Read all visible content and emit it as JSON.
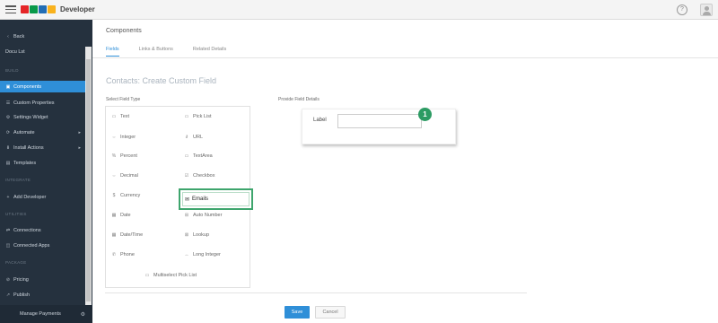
{
  "app": {
    "title": "Developer",
    "logo_colors": [
      "#e42527",
      "#089949",
      "#226db4",
      "#f9b21d"
    ]
  },
  "topbar": {
    "help_icon": "help-icon",
    "user_icon": "user-icon"
  },
  "sidebar": {
    "back_label": "Back",
    "app_name": "Docu Lst",
    "sections": {
      "build": "BUILD",
      "integrate": "INTEGRATE",
      "utilities": "UTILITIES",
      "package": "PACKAGE"
    },
    "items": [
      {
        "label": "Components",
        "icon": "components-icon",
        "active": true
      },
      {
        "label": "Custom Properties",
        "icon": "properties-icon"
      },
      {
        "label": "Settings Widget",
        "icon": "settings-icon"
      },
      {
        "label": "Automate",
        "icon": "automate-icon"
      },
      {
        "label": "Install Actions",
        "icon": "install-icon"
      },
      {
        "label": "Templates",
        "icon": "templates-icon"
      },
      {
        "label": "Add Developer",
        "icon": "add-developer-icon"
      },
      {
        "label": "Connections",
        "icon": "connections-icon"
      },
      {
        "label": "Connected Apps",
        "icon": "connected-apps-icon"
      },
      {
        "label": "Pricing",
        "icon": "pricing-icon"
      },
      {
        "label": "Publish",
        "icon": "publish-icon"
      }
    ],
    "footer_label": "Manage Payments",
    "accent_color": "#2f8fd8"
  },
  "page": {
    "title": "Components",
    "tabs": [
      {
        "label": "Fields",
        "active": true
      },
      {
        "label": "Links & Buttons"
      },
      {
        "label": "Related Details"
      }
    ],
    "form_title": "Contacts: Create Custom Field",
    "select_field_type_label": "Select Field Type",
    "provide_details_label": "Provide Field Details"
  },
  "field_types": [
    {
      "label": "Text",
      "icon": "text-icon"
    },
    {
      "label": "Pick List",
      "icon": "picklist-icon"
    },
    {
      "label": "Integer",
      "icon": "integer-icon"
    },
    {
      "label": "URL",
      "icon": "url-icon"
    },
    {
      "label": "Percent",
      "icon": "percent-icon"
    },
    {
      "label": "TextArea",
      "icon": "textarea-icon"
    },
    {
      "label": "Decimal",
      "icon": "decimal-icon"
    },
    {
      "label": "Checkbox",
      "icon": "checkbox-icon"
    },
    {
      "label": "Currency",
      "icon": "currency-icon"
    },
    {
      "label": "Emails",
      "icon": "email-icon",
      "highlighted": true
    },
    {
      "label": "Date",
      "icon": "date-icon"
    },
    {
      "label": "Auto Number",
      "icon": "autonumber-icon"
    },
    {
      "label": "Date/Time",
      "icon": "datetime-icon"
    },
    {
      "label": "Lookup",
      "icon": "lookup-icon"
    },
    {
      "label": "Phone",
      "icon": "phone-icon"
    },
    {
      "label": "Long Integer",
      "icon": "longinteger-icon"
    },
    {
      "label": "Multiselect Pick List",
      "icon": "multiselect-icon"
    }
  ],
  "details": {
    "label_field": {
      "label": "Label",
      "value": "",
      "placeholder": ""
    },
    "step_badge": "1",
    "badge_color": "#2c9b63"
  },
  "actions": {
    "save_label": "Save",
    "cancel_label": "Cancel"
  }
}
